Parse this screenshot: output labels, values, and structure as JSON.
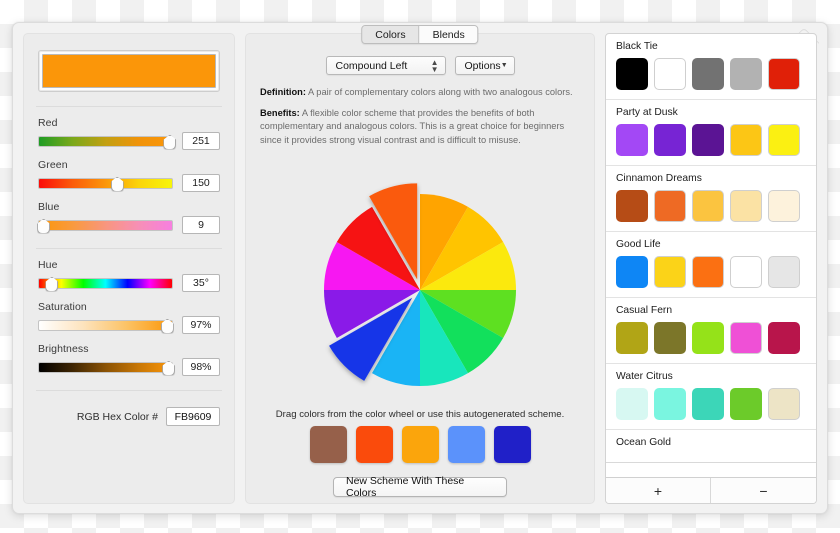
{
  "window": {
    "kind": "popover"
  },
  "left_panel": {
    "preview_color": "#FB9609",
    "rgb_sliders": [
      {
        "label": "Red",
        "value": "251",
        "percent": 98.4,
        "gradient": "linear-gradient(to right,#1f9c24,#7aa81b,#c2a012,#f0930a,#fb9609)"
      },
      {
        "label": "Green",
        "value": "150",
        "percent": 58.8,
        "gradient": "linear-gradient(to right,#fb0c09,#fb5b09,#fb9609,#fbd409,#f7f50a)"
      },
      {
        "label": "Blue",
        "value": "9",
        "percent": 3.5,
        "gradient": "linear-gradient(to right,#fb9609,#f99a3d,#f8967e,#f78fb6,#f77fe0)"
      }
    ],
    "hsb_sliders": [
      {
        "label": "Hue",
        "value": "35°",
        "percent": 9.7,
        "gradient": "linear-gradient(to right,#ff0000,#ffff00,#00ff00,#00ffff,#0000ff,#ff00ff,#ff0000)"
      },
      {
        "label": "Saturation",
        "value": "97%",
        "percent": 96.5,
        "gradient": "linear-gradient(to right,#ffffff,#fde3bd,#fcc263,#fb9609)"
      },
      {
        "label": "Brightness",
        "value": "98%",
        "percent": 97.5,
        "gradient": "linear-gradient(to right,#000000,#3e2502,#8a5204,#c87706,#fb9609)"
      }
    ],
    "hex": {
      "label": "RGB Hex Color #",
      "value": "FB9609"
    }
  },
  "center_panel": {
    "tabs": [
      {
        "label": "Colors",
        "active": false
      },
      {
        "label": "Blends",
        "active": true
      }
    ],
    "scheme_select": {
      "value": "Compound Left"
    },
    "options_button": {
      "label": "Options"
    },
    "definition": {
      "term": "Definition:",
      "text": " A pair of complementary colors along with two analogous colors."
    },
    "benefits": {
      "term": "Benefits:",
      "text": " A flexible color scheme that provides the benefits of both complementary and analogous colors. This is a great choice for beginners since it provides strong visual contrast and is difficult to misuse."
    },
    "wheel": {
      "segments": [
        {
          "color": "#ffa400",
          "exploded": false
        },
        {
          "color": "#ffc400",
          "exploded": false
        },
        {
          "color": "#fbe90d",
          "exploded": false
        },
        {
          "color": "#5ee021",
          "exploded": false
        },
        {
          "color": "#12e05c",
          "exploded": false
        },
        {
          "color": "#18e6bc",
          "exploded": false
        },
        {
          "color": "#1ab4f5",
          "exploded": false
        },
        {
          "color": "#1736e8",
          "exploded": true
        },
        {
          "color": "#8a1ae8",
          "exploded": false
        },
        {
          "color": "#f717f2",
          "exploded": false
        },
        {
          "color": "#f61313",
          "exploded": false
        },
        {
          "color": "#fa5a0c",
          "exploded": true
        }
      ]
    },
    "drag_hint": "Drag colors from the color wheel or use this autogenerated scheme.",
    "generated_scheme": [
      "#96604a",
      "#fa4b0c",
      "#fba50c",
      "#5b92fb",
      "#2020c8"
    ],
    "new_scheme_button": "New Scheme With These Colors"
  },
  "right_panel": {
    "groups": [
      {
        "name": "Black Tie",
        "colors": [
          "#000000",
          "#ffffff",
          "#727272",
          "#b2b2b2",
          "#e02008"
        ]
      },
      {
        "name": "Party at Dusk",
        "colors": [
          "#a348f5",
          "#7724d4",
          "#5b1494",
          "#fcc615",
          "#fbf012"
        ]
      },
      {
        "name": "Cinnamon Dreams",
        "colors": [
          "#b64c16",
          "#ee6a24",
          "#fbc440",
          "#fbe2a4",
          "#fdf2dc"
        ]
      },
      {
        "name": "Good Life",
        "colors": [
          "#0e86f5",
          "#fbd318",
          "#fb7012",
          "#ffffff",
          "#e6e6e6"
        ]
      },
      {
        "name": "Casual Fern",
        "colors": [
          "#b1a516",
          "#7c7629",
          "#95e219",
          "#ef50d6",
          "#b8154b"
        ]
      },
      {
        "name": "Water Citrus",
        "colors": [
          "#d7f8f2",
          "#7af5e0",
          "#3cd6b8",
          "#6ccb2a",
          "#ede4c6"
        ]
      },
      {
        "name": "Ocean Gold",
        "colors": []
      }
    ],
    "footer": {
      "add": "+",
      "remove": "−"
    }
  }
}
